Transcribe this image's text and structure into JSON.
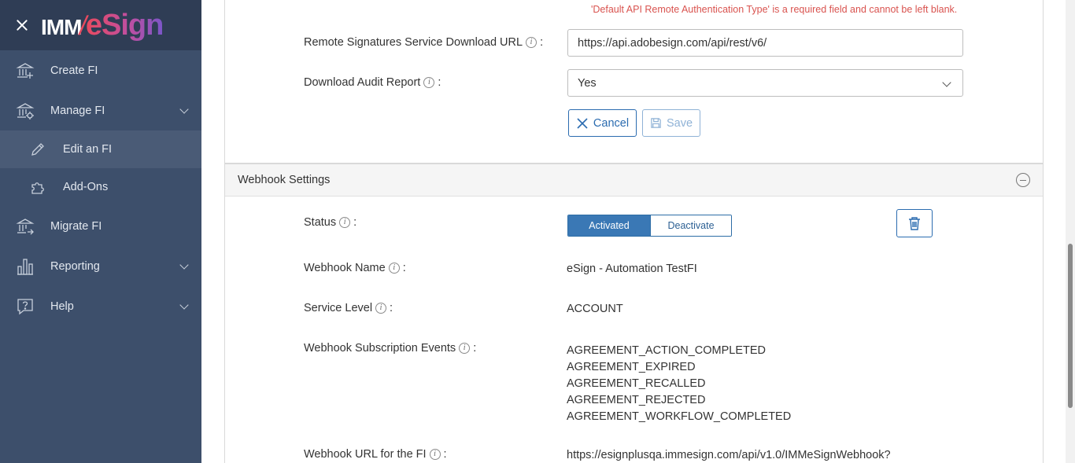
{
  "sidebar": {
    "logo": {
      "part1": "IMM",
      "slash": "/",
      "part2": "eSign"
    },
    "items": [
      {
        "label": "Create FI",
        "icon": "bank-plus-icon"
      },
      {
        "label": "Manage FI",
        "icon": "bank-gear-icon"
      },
      {
        "label": "Edit an FI",
        "icon": "pencil-icon"
      },
      {
        "label": "Add-Ons",
        "icon": "puzzle-icon"
      },
      {
        "label": "Migrate FI",
        "icon": "bank-arrow-icon"
      },
      {
        "label": "Reporting",
        "icon": "bar-chart-icon"
      },
      {
        "label": "Help",
        "icon": "help-chat-icon"
      }
    ]
  },
  "form": {
    "error": "'Default API Remote Authentication Type' is a required field and cannot be left blank.",
    "download_url_label": "Remote Signatures Service Download URL",
    "download_url_value": "https://api.adobesign.com/api/rest/v6/",
    "audit_label": "Download Audit Report",
    "audit_value": "Yes",
    "colon": ":",
    "cancel": "Cancel",
    "save": "Save"
  },
  "webhook": {
    "title": "Webhook Settings",
    "status_label": "Status",
    "activated": "Activated",
    "deactivate": "Deactivate",
    "name_label": "Webhook Name",
    "name_value": "eSign - Automation TestFI",
    "level_label": "Service Level",
    "level_value": "ACCOUNT",
    "events_label": "Webhook Subscription Events",
    "events": [
      "AGREEMENT_ACTION_COMPLETED",
      "AGREEMENT_EXPIRED",
      "AGREEMENT_RECALLED",
      "AGREEMENT_REJECTED",
      "AGREEMENT_WORKFLOW_COMPLETED"
    ],
    "url_label": "Webhook URL for the FI",
    "url_value": "https://esignplusqa.immesign.com/api/v1.0/IMMeSignWebhook?"
  },
  "info_glyph": "i"
}
